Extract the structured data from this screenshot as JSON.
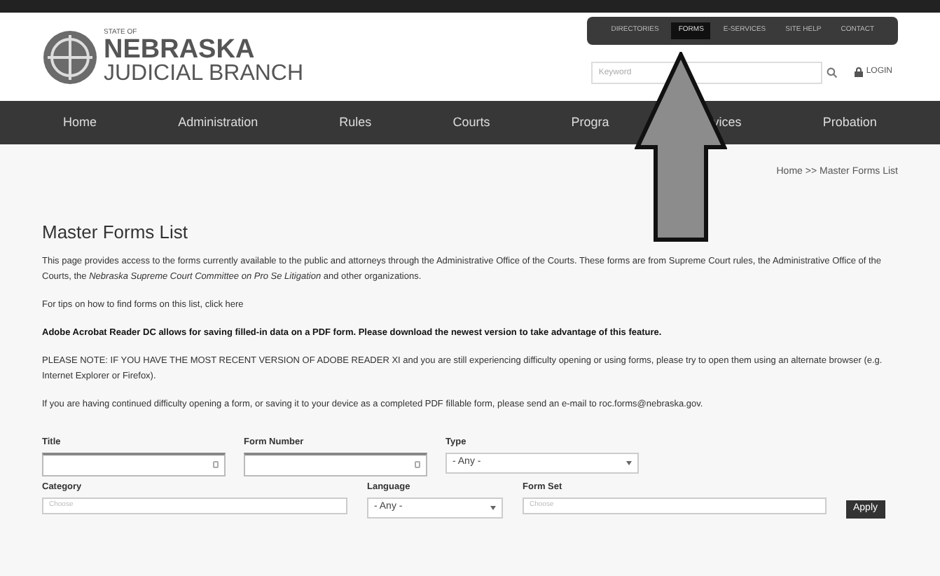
{
  "logo": {
    "state": "STATE OF",
    "name": "NEBRASKA",
    "branch": "JUDICIAL BRANCH"
  },
  "utility_links": [
    {
      "label": "DIRECTORIES",
      "selected": false
    },
    {
      "label": "FORMS",
      "selected": true
    },
    {
      "label": "E-SERVICES",
      "selected": false
    },
    {
      "label": "SITE HELP",
      "selected": false
    },
    {
      "label": "CONTACT",
      "selected": false
    }
  ],
  "search": {
    "placeholder": "Keyword"
  },
  "login": "LOGIN",
  "nav": [
    {
      "label": "Home"
    },
    {
      "label": "Administration"
    },
    {
      "label": "Rules"
    },
    {
      "label": "Courts"
    },
    {
      "label": "Progra",
      "label_end": "vices"
    },
    {
      "label": "Probation"
    }
  ],
  "breadcrumb": "Home >> Master Forms List",
  "title": "Master Forms List",
  "paragraphs": [
    {
      "kind": "plain",
      "text": "This page provides access to the forms currently available to the public and attorneys through the Administrative Office of the Courts. These forms are from Supreme Court rules, the Administrative Office of the Courts, the *Nebraska Supreme Court Committee on Pro Se Litigation* and other organizations."
    },
    {
      "kind": "plain",
      "text": "For tips on how to find forms on this list, click here"
    },
    {
      "kind": "bold",
      "text": "Adobe Acrobat Reader DC allows for saving filled-in data on a PDF form. Please download the newest version to take advantage of this feature."
    },
    {
      "kind": "plain",
      "text": "PLEASE NOTE: IF YOU HAVE THE MOST RECENT VERSION OF ADOBE READER XI and you are still experiencing difficulty opening or using forms, please try to open them using an alternate browser (e.g. Internet Explorer or Firefox)."
    },
    {
      "kind": "plain",
      "text": "If you are having continued difficulty opening a form, or saving it to your device as a completed PDF fillable form, please send an e-mail to roc.forms@nebraska.gov."
    }
  ],
  "filters_row1": [
    {
      "label": "Title",
      "kind": "text"
    },
    {
      "label": "Form Number",
      "kind": "text"
    },
    {
      "label": "Type",
      "kind": "select",
      "value": "- Any -"
    }
  ],
  "filters_row2": [
    {
      "label": "Category",
      "kind": "choose",
      "placeholder": "Choose"
    },
    {
      "label": "Language",
      "kind": "select",
      "value": "- Any -"
    },
    {
      "label": "Form Set",
      "kind": "choose",
      "placeholder": "Choose"
    }
  ],
  "apply": "Apply"
}
